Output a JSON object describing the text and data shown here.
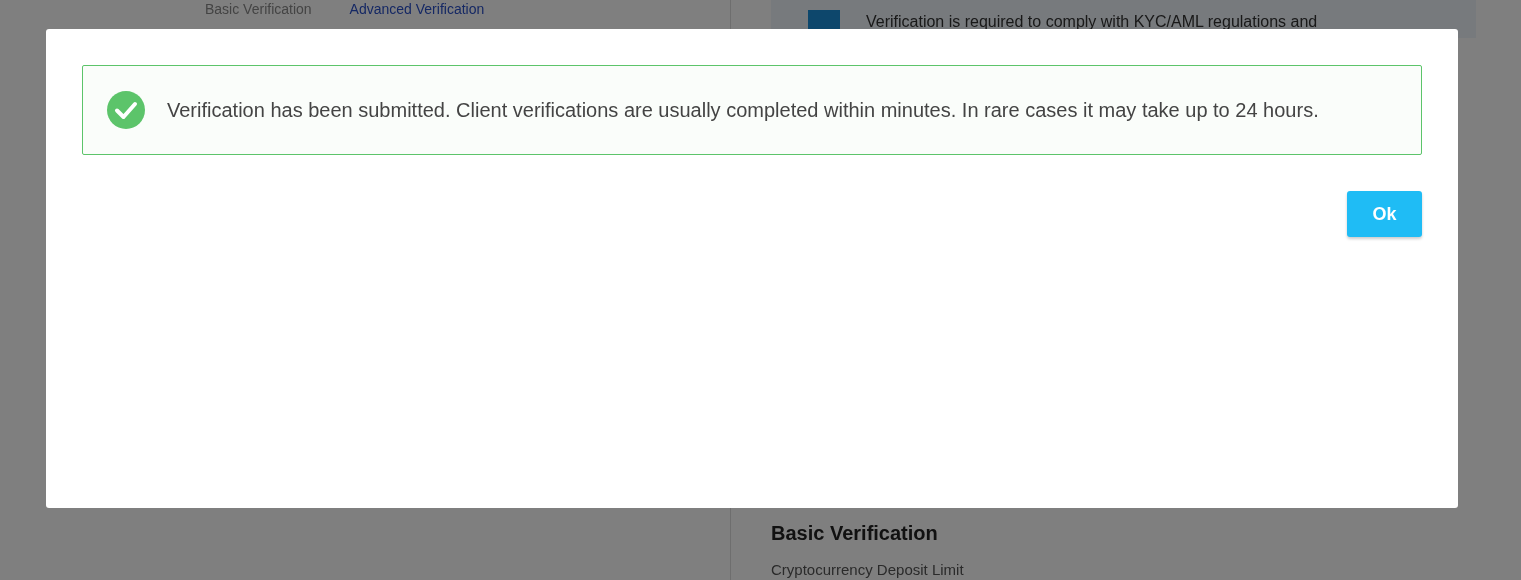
{
  "background": {
    "tabs": [
      {
        "label": "Basic Verification",
        "selected": false
      },
      {
        "label": "Advanced Verification",
        "selected": true
      }
    ],
    "info": "Verification is required to comply with KYC/AML regulations and",
    "heading": "Basic Verification",
    "limit_label": "Cryptocurrency Deposit Limit"
  },
  "dialog": {
    "alert": {
      "kind": "success",
      "message": "Verification has been submitted. Client verifications are usually completed within minutes. In rare cases it may take up to 24 hours."
    },
    "buttons": [
      "Ok"
    ]
  }
}
